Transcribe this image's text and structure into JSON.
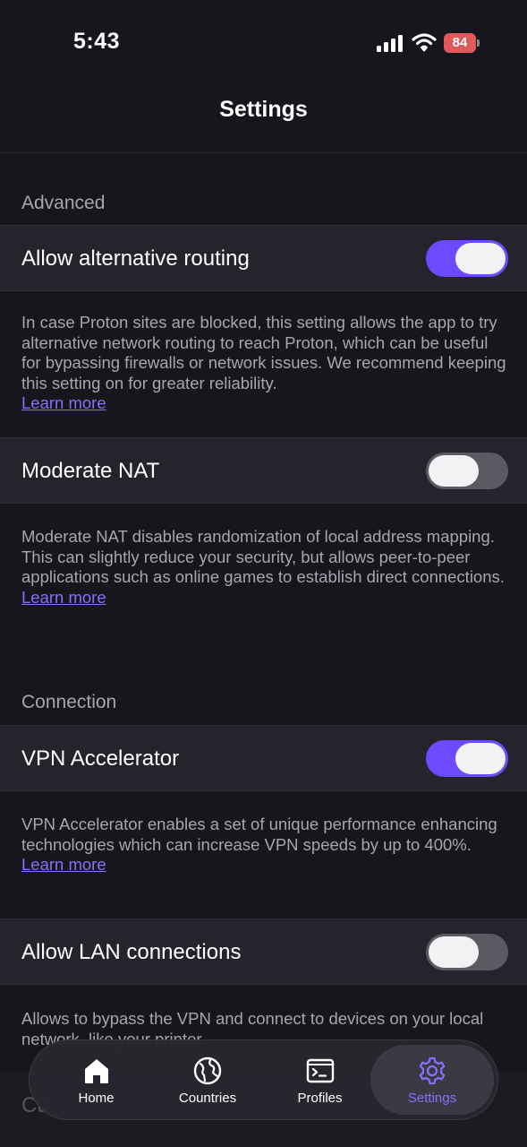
{
  "status_bar": {
    "time": "5:43",
    "battery": "84",
    "battery_color": "#e0585a"
  },
  "nav": {
    "title": "Settings"
  },
  "sections": {
    "advanced": {
      "header": "Advanced",
      "alt_routing": {
        "label": "Allow alternative routing",
        "enabled": true,
        "description": "In case Proton sites are blocked, this setting allows the app to try alternative network routing to reach Proton, which can be useful for bypassing firewalls or network issues. We recommend keeping this setting on for greater reliability.",
        "learn_more": "Learn more"
      },
      "moderate_nat": {
        "label": "Moderate NAT",
        "enabled": false,
        "description": "Moderate NAT disables randomization of local address mapping. This can slightly reduce your security, but allows peer-to-peer applications such as online games to establish direct connections.",
        "learn_more": "Learn more"
      }
    },
    "connection": {
      "header": "Connection",
      "vpn_accelerator": {
        "label": "VPN Accelerator",
        "enabled": true,
        "description": "VPN Accelerator enables a set of unique performance enhancing technologies which can increase VPN speeds by up to 400%.",
        "learn_more": "Learn more"
      },
      "lan": {
        "label": "Allow LAN connections",
        "enabled": false,
        "description": "Allows to bypass the VPN and connect to devices on your local network, like your printer."
      }
    },
    "partial_row": {
      "label": "Cu"
    }
  },
  "tab_bar": {
    "items": [
      {
        "label": "Home",
        "icon": "home-icon"
      },
      {
        "label": "Countries",
        "icon": "globe-icon"
      },
      {
        "label": "Profiles",
        "icon": "terminal-icon"
      },
      {
        "label": "Settings",
        "icon": "gear-icon",
        "active": true
      }
    ]
  },
  "colors": {
    "accent": "#6d4aff",
    "link": "#8a6eff",
    "background": "#17161c",
    "row_background": "#25232c"
  }
}
